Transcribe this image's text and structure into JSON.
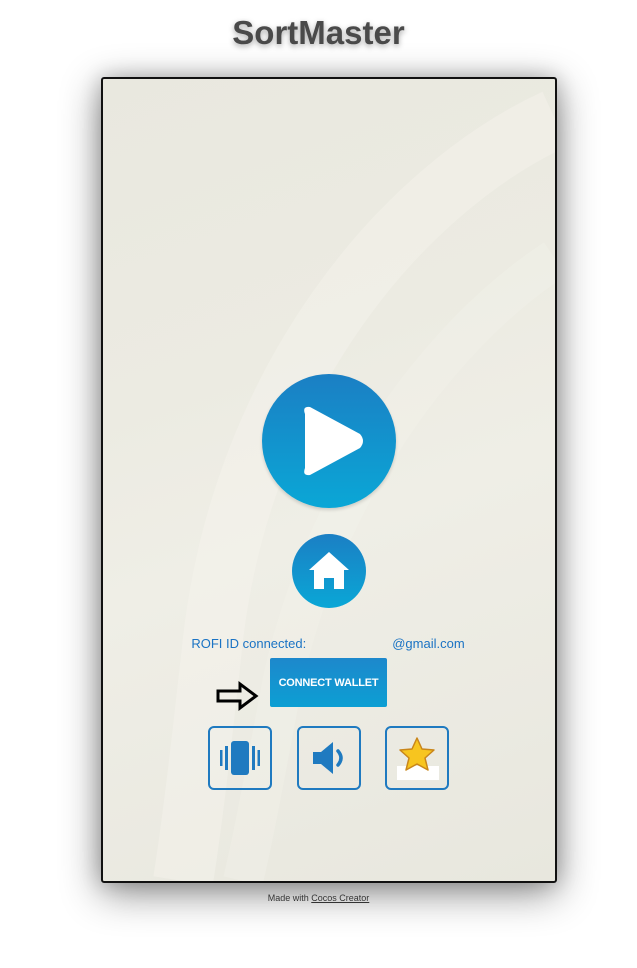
{
  "page": {
    "title": "SortMaster"
  },
  "game": {
    "rofi_prefix": "ROFI ID connected:",
    "rofi_email_suffix": "@gmail.com",
    "connect_wallet_label": "CONNECT WALLET",
    "buttons": {
      "play": "play-icon",
      "home": "home-icon",
      "vibrate": "vibration-icon",
      "sound": "speaker-icon",
      "rate": "star-icon"
    }
  },
  "footer": {
    "made_with": "Made with",
    "link_text": "Cocos Creator"
  },
  "colors": {
    "accent": "#1a73c4",
    "button_top": "#1b7fc4",
    "button_bottom": "#0aa7d6",
    "star": "#f7c51f"
  }
}
